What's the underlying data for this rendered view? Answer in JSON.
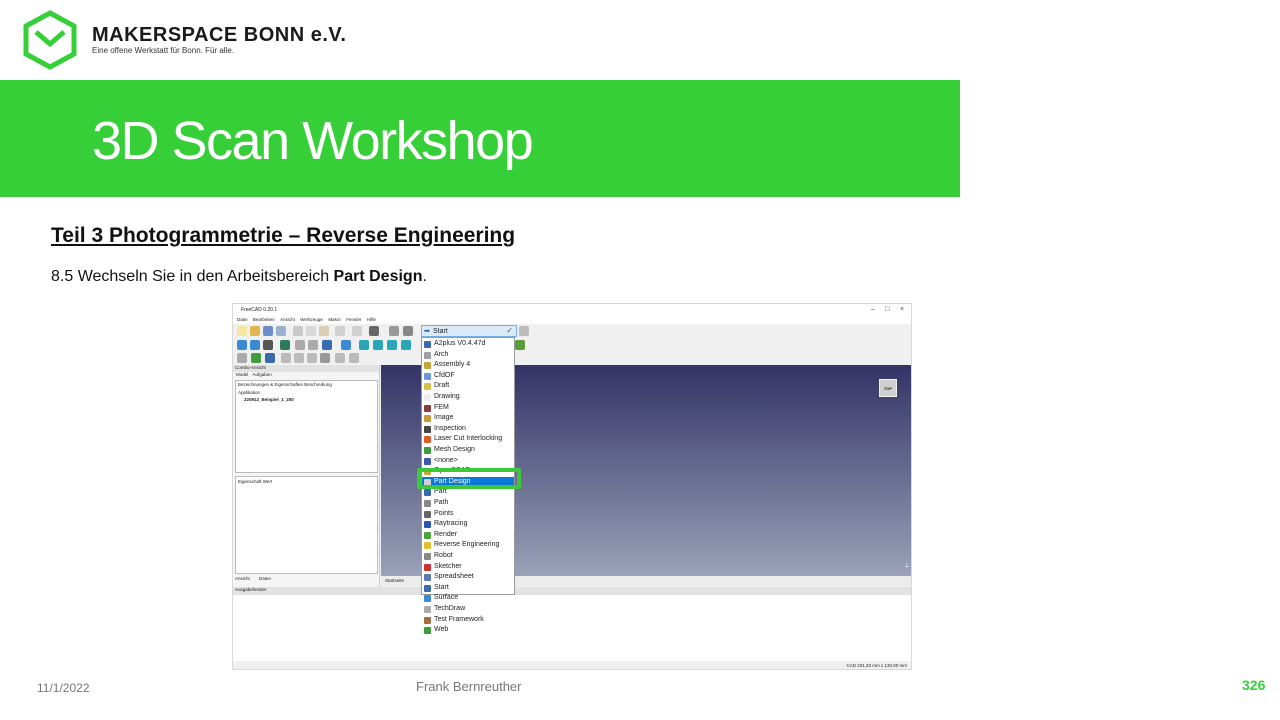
{
  "header": {
    "brand": "MAKERSPACE BONN e.V.",
    "tagline": "Eine offene Werkstatt für Bonn. Für alle.",
    "logo_icon": "hexagon-heart-logo",
    "accent": "#36cf38"
  },
  "banner": {
    "title": "3D Scan Workshop"
  },
  "content": {
    "section_title": "Teil 3  Photogrammetrie  – Reverse Engineering",
    "instruction_prefix": "8.5 Wechseln Sie in den Arbeitsbereich ",
    "instruction_bold": "Part Design",
    "instruction_suffix": "."
  },
  "app": {
    "title": "FreeCAD 0.20.1",
    "window_controls": [
      "–",
      "□",
      "×"
    ],
    "menu": [
      "Datei",
      "Bearbeiten",
      "Ansicht",
      "Werkzeuge",
      "Makro",
      "Fenster",
      "Hilfe"
    ],
    "combo_view": "Combo-Ansicht",
    "combo_tabs": [
      "Model",
      "Aufgaben"
    ],
    "tree_header": "Bezeichnungen & Eigenschaften    Beschreibung",
    "tree_app": "Applikation",
    "tree_file": "220912_Beispiel_1_200",
    "props_header": "Eigenschaft          Wert",
    "props_tabs": [
      "Ansicht",
      "Daten"
    ],
    "startseite": "Startseite",
    "output": "Ausgabefenster",
    "status": "CAD   231,33 mm x 130,00 mm",
    "navcube": "TOP",
    "workbench_selected": "Start",
    "workbenches": [
      "A2plus V0.4.47d",
      "Arch",
      "Assembly 4",
      "CfdOF",
      "Draft",
      "Drawing",
      "FEM",
      "Image",
      "Inspection",
      "Laser Cut Interlocking",
      "Mesh Design",
      "<none>",
      "OpenSCAD",
      "Part Design",
      "Part",
      "Path",
      "Points",
      "Raytracing",
      "Render",
      "Reverse Engineering",
      "Robot",
      "Sketcher",
      "Spreadsheet",
      "Start",
      "Surface",
      "TechDraw",
      "Test Framework",
      "Web"
    ],
    "workbench_highlight": "Part Design",
    "highlight_color": "#3cc83a",
    "selected_color": "#0a78d7"
  },
  "footer": {
    "date": "11/1/2022",
    "author": "Frank Bernreuther",
    "page": "326"
  }
}
